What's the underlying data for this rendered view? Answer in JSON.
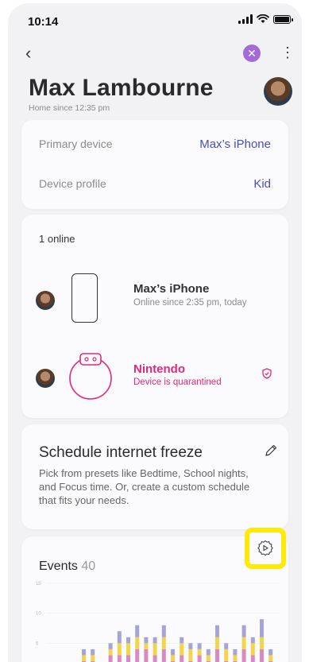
{
  "status_bar": {
    "time": "10:14"
  },
  "header": {
    "name": "Max Lambourne",
    "subtitle": "Home since 12:35 pm"
  },
  "device_info": {
    "primary_label": "Primary device",
    "primary_value": "Max’s iPhone",
    "profile_label": "Device profile",
    "profile_value": "Kid"
  },
  "devices": {
    "online_label": "1 online",
    "items": [
      {
        "name": "Max’s iPhone",
        "status": "Online since 2:35 pm, today"
      },
      {
        "name": "Nintendo",
        "status": "Device is quarantined"
      }
    ]
  },
  "schedule": {
    "title": "Schedule internet freeze",
    "body": "Pick from presets like Bedtime, School nights, and Focus time. Or, create a custom schedule that fits your needs."
  },
  "events": {
    "label": "Events",
    "count": "40"
  },
  "colors": {
    "accent_blue": "#4a4fb0",
    "quarantine_pink": "#e3287a",
    "close_purple": "#a36ad8",
    "highlight_yellow": "#ffe90a"
  },
  "chart_data": {
    "type": "bar",
    "stacked": true,
    "y_ticks": [
      "15",
      "10",
      "5"
    ],
    "ylim": [
      0,
      15
    ],
    "series": [
      {
        "color": "#d98ac5",
        "values": [
          2,
          2,
          0,
          3,
          3,
          3,
          4,
          4,
          3,
          4,
          2,
          3,
          2,
          3,
          2,
          4,
          2,
          2,
          4,
          3,
          4,
          2
        ]
      },
      {
        "color": "#f3d44a",
        "values": [
          1,
          1,
          0,
          1,
          2,
          2,
          2,
          1,
          2,
          2,
          1,
          2,
          2,
          1,
          1,
          2,
          2,
          1,
          2,
          2,
          2,
          1
        ]
      },
      {
        "color": "#a5a4d8",
        "values": [
          1,
          1,
          0,
          1,
          2,
          1,
          2,
          1,
          1,
          2,
          1,
          1,
          1,
          1,
          1,
          2,
          1,
          1,
          2,
          1,
          3,
          1
        ]
      }
    ]
  }
}
